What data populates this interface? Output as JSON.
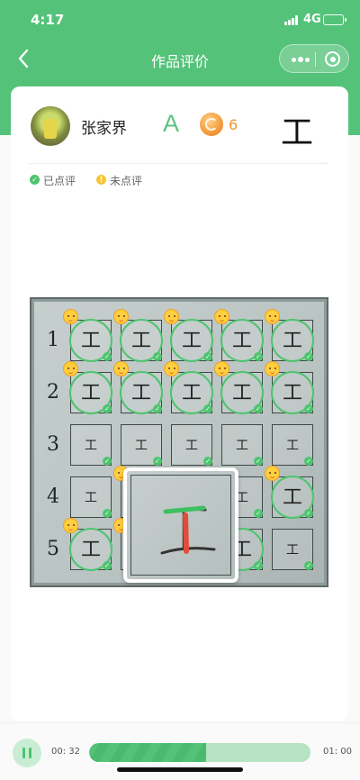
{
  "status": {
    "time": "4:17",
    "network": "4G"
  },
  "nav": {
    "title": "作品评价",
    "back_icon": "chevron-left-icon",
    "more_icon": "more-dots-icon",
    "target_icon": "target-icon"
  },
  "student": {
    "name": "张家界",
    "grade": "A",
    "coins": "6",
    "character": "工"
  },
  "legend": {
    "reviewed": {
      "label": "已点评",
      "color": "#4ec46f"
    },
    "unreviewed": {
      "label": "未点评",
      "color": "#f5c437"
    }
  },
  "worksheet": {
    "row_labels": [
      "1",
      "2",
      "3",
      "4",
      "5"
    ],
    "cell_character": "工",
    "rows": [
      {
        "cells": [
          {
            "reviewed": true,
            "emoji": true
          },
          {
            "reviewed": true,
            "emoji": true
          },
          {
            "reviewed": true,
            "emoji": true
          },
          {
            "reviewed": true,
            "emoji": true
          },
          {
            "reviewed": true,
            "emoji": true
          }
        ]
      },
      {
        "cells": [
          {
            "reviewed": true,
            "emoji": true
          },
          {
            "reviewed": true,
            "emoji": true
          },
          {
            "reviewed": true,
            "emoji": true
          },
          {
            "reviewed": true,
            "emoji": true
          },
          {
            "reviewed": true,
            "emoji": true
          }
        ]
      },
      {
        "cells": [
          {
            "reviewed": false,
            "emoji": false,
            "checked": true
          },
          {
            "reviewed": false,
            "emoji": false,
            "checked": true
          },
          {
            "reviewed": false,
            "emoji": false,
            "checked": true
          },
          {
            "reviewed": false,
            "emoji": false,
            "checked": true
          },
          {
            "reviewed": false,
            "emoji": false,
            "checked": true
          }
        ]
      },
      {
        "cells": [
          {
            "reviewed": false,
            "emoji": false,
            "checked": true
          },
          {
            "reviewed": false,
            "emoji": true,
            "checked": true
          },
          {
            "reviewed": false,
            "emoji": false,
            "checked": true
          },
          {
            "reviewed": false,
            "emoji": false,
            "checked": true
          },
          {
            "reviewed": true,
            "emoji": true
          }
        ]
      },
      {
        "cells": [
          {
            "reviewed": true,
            "emoji": true
          },
          {
            "reviewed": false,
            "emoji": true,
            "checked": true
          },
          {
            "reviewed": false,
            "emoji": false,
            "checked": true
          },
          {
            "reviewed": true,
            "emoji": false
          },
          {
            "reviewed": false,
            "emoji": false,
            "checked": true
          }
        ]
      }
    ]
  },
  "player": {
    "elapsed": "00: 32",
    "total": "01: 00",
    "progress": 0.53,
    "pause_icon": "pause-icon"
  }
}
